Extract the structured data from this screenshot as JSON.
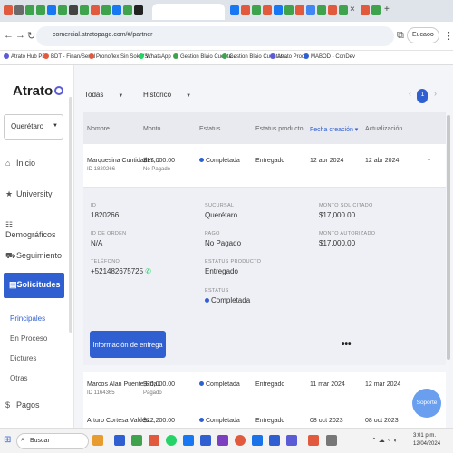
{
  "browser": {
    "url": "comercial.atratopago.com/#/partner",
    "profile_label": "Eucaoo",
    "bookmarks": [
      "Atrato Hub PD",
      "BDT - Finan/Serial",
      "Pronoflex Sin Sok VSL",
      "WhatsApp",
      "Gestion Blaio Cuenta...",
      "Gestion Blaio Cuentas...",
      "Atrato Prod",
      "MABOD - ConDev"
    ]
  },
  "sidebar": {
    "logo": "Atrato",
    "city": "Querétaro",
    "nav": [
      {
        "icon": "⌂",
        "label": "Inicio"
      },
      {
        "icon": "★",
        "label": "University"
      },
      {
        "icon": "☷",
        "label": "Demográficos"
      },
      {
        "icon": "⛟",
        "label": "Seguimiento"
      }
    ],
    "active": {
      "icon": "▤",
      "label": "Solicitudes"
    },
    "sub_items": [
      "Principales",
      "En Proceso",
      "Dictures",
      "Otras"
    ],
    "pagos": {
      "icon": "$",
      "label": "Pagos"
    }
  },
  "filters": {
    "filter1": "Todas",
    "filter2": "Histórico"
  },
  "pager": {
    "prev": "‹",
    "current": "1",
    "next": "›"
  },
  "table": {
    "headers": [
      "Nombre",
      "Monto",
      "Estatus",
      "Estatus producto",
      "Fecha creación ▾",
      "Actualización"
    ],
    "rows": [
      {
        "name": "Marquesina Cuntidades...",
        "id": "ID 1820266",
        "amount": "$17,000.00",
        "amount_sub": "No Pagado",
        "status": "Completada",
        "product": "Entregado",
        "created": "12 abr 2024",
        "updated": "12 abr 2024"
      },
      {
        "name": "Marcos Alan Puente Hda..",
        "id": "ID 1164365",
        "amount": "$20,000.00",
        "amount_sub": "Pagado",
        "status": "Completada",
        "product": "Entregado",
        "created": "11 mar 2024",
        "updated": "12 mar 2024"
      },
      {
        "name": "Arturo Cortesa Valdés...",
        "id": "",
        "amount": "$22,200.00",
        "amount_sub": "",
        "status": "Completada",
        "product": "Entregado",
        "created": "08 oct 2023",
        "updated": "08 oct 2023"
      }
    ]
  },
  "detail": {
    "id_label": "ID",
    "id_value": "1820266",
    "sucursal_label": "SUCURSAL",
    "sucursal_value": "Querétaro",
    "monto_sol_label": "MONTO SOLICITADO",
    "monto_sol_value": "$17,000.00",
    "orden_label": "ID DE ORDEN",
    "orden_value": "N/A",
    "pago_label": "PAGO",
    "pago_value": "No Pagado",
    "monto_aut_label": "MONTO AUTORIZADO",
    "monto_aut_value": "$17,000.00",
    "tel_label": "TELÉFONO",
    "tel_value": "+521482675725",
    "est_prod_label": "ESTATUS PRODUCTO",
    "est_prod_value": "Entregado",
    "est_label": "ESTATUS",
    "est_value": "Completada",
    "button": "Información de entrega",
    "more": "•••"
  },
  "soporte": "Soporte",
  "taskbar": {
    "search": "Buscar",
    "time": "3:01 p.m.",
    "date": "12/04/2024"
  },
  "colors": {
    "accent": "#2f5fd1",
    "soporte": "#6a9ff0"
  }
}
